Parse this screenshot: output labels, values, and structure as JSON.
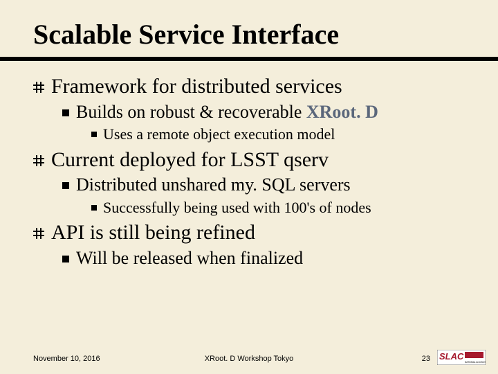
{
  "title": "Scalable Service Interface",
  "bullets": {
    "b1": "Framework for distributed services",
    "b1_1_pre": "Builds on robust & recoverable ",
    "b1_1_em": "XRoot. D",
    "b1_1_1": "Uses a remote object execution model",
    "b2": "Current deployed for LSST qserv",
    "b2_1": "Distributed unshared my. SQL servers",
    "b2_1_1": "Successfully being used with 100's of nodes",
    "b3": "API is still being refined",
    "b3_1": "Will be released when finalized"
  },
  "footer": {
    "date": "November 10, 2016",
    "center": "XRoot. D Workshop Tokyo",
    "page": "23"
  }
}
